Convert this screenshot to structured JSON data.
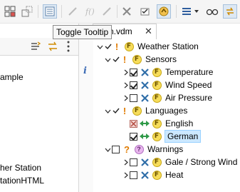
{
  "tooltip": {
    "text": "Toggle Tooltip"
  },
  "editor_tab": {
    "label": "n.vdm",
    "close": "✕"
  },
  "left_panel": {
    "lines": [
      {
        "text": "ample"
      },
      {
        "text": "her Station"
      },
      {
        "text": "tationHTML"
      }
    ]
  },
  "gutter": {
    "info": "i"
  },
  "tree": {
    "root": {
      "label": "Weather Station",
      "marker": "!"
    },
    "sensors": {
      "label": "Sensors",
      "marker": "!",
      "items": [
        {
          "label": "Temperature",
          "checked": true
        },
        {
          "label": "Wind Speed",
          "checked": true
        },
        {
          "label": "Air Pressure",
          "checked": false
        }
      ]
    },
    "languages": {
      "label": "Languages",
      "marker": "!",
      "items": [
        {
          "label": "English",
          "checked": false
        },
        {
          "label": "German",
          "checked": true,
          "selected": true
        }
      ]
    },
    "warnings": {
      "label": "Warnings",
      "marker": "?",
      "items": [
        {
          "label": "Gale / Strong Wind",
          "checked": false
        },
        {
          "label": "Heat",
          "checked": false
        }
      ]
    },
    "badge_letter": "F",
    "optional_letter": "?"
  },
  "colors": {
    "selection": "#cce8ff",
    "feature_badge": "#f6dc5a",
    "optional_badge": "#e8b7ee",
    "warning_marker": "#e07a00",
    "remove_x": "#2f6ea8",
    "green_arrow": "#2f9a48"
  }
}
